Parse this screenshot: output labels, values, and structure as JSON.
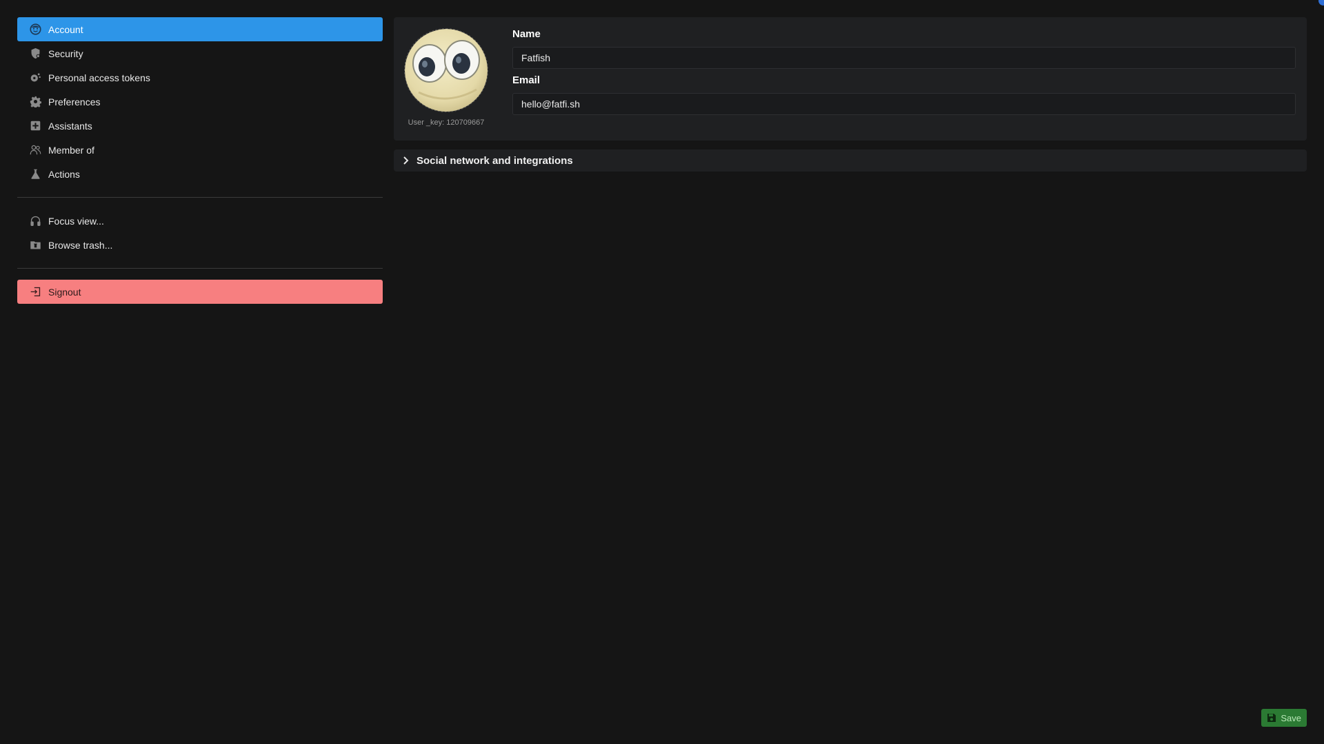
{
  "sidebar": {
    "primary": [
      {
        "label": "Account",
        "icon": "user-face-icon",
        "active": true
      },
      {
        "label": "Security",
        "icon": "shield-icon"
      },
      {
        "label": "Personal access tokens",
        "icon": "key-icon"
      },
      {
        "label": "Preferences",
        "icon": "gear-icon"
      },
      {
        "label": "Assistants",
        "icon": "robot-icon"
      },
      {
        "label": "Member of",
        "icon": "users-icon"
      },
      {
        "label": "Actions",
        "icon": "flask-icon"
      }
    ],
    "secondary": [
      {
        "label": "Focus view...",
        "icon": "headphones-icon"
      },
      {
        "label": "Browse trash...",
        "icon": "trash-folder-icon"
      }
    ],
    "signout": {
      "label": "Signout",
      "icon": "sign-out-icon"
    }
  },
  "profile": {
    "user_key": "User _key: 120709667",
    "name_label": "Name",
    "name_value": "Fatfish",
    "email_label": "Email",
    "email_value": "hello@fatfi.sh"
  },
  "social": {
    "label": "Social network and integrations"
  },
  "footer": {
    "save_label": "Save"
  },
  "colors": {
    "background": "#151515",
    "card": "#1f2022",
    "active": "#2d95e8",
    "danger": "#f77f80",
    "save": "#2b7a33"
  }
}
